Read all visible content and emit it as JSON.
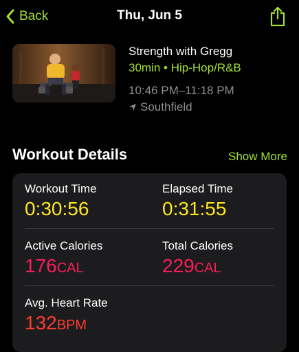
{
  "nav": {
    "back_label": "Back",
    "title": "Thu, Jun 5",
    "share_icon": "share-icon"
  },
  "workout": {
    "title": "Strength with Gregg",
    "duration": "30min",
    "separator": "•",
    "music": "Hip-Hop/R&B",
    "time_range": "10:46 PM–11:18 PM",
    "location": "Southfield"
  },
  "details": {
    "section_title": "Workout Details",
    "show_more": "Show More",
    "workout_time": {
      "label": "Workout Time",
      "value": "0:30:56"
    },
    "elapsed_time": {
      "label": "Elapsed Time",
      "value": "0:31:55"
    },
    "active_calories": {
      "label": "Active Calories",
      "value": "176",
      "unit": "CAL"
    },
    "total_calories": {
      "label": "Total Calories",
      "value": "229",
      "unit": "CAL"
    },
    "heart_rate": {
      "label": "Avg. Heart Rate",
      "value": "132",
      "unit": "BPM"
    }
  },
  "colors": {
    "accent": "#a4e033",
    "time_value": "#ffe620",
    "calorie_value": "#fa1e5a",
    "heart_value": "#ff3b30",
    "card_bg": "#1c1c1e"
  }
}
